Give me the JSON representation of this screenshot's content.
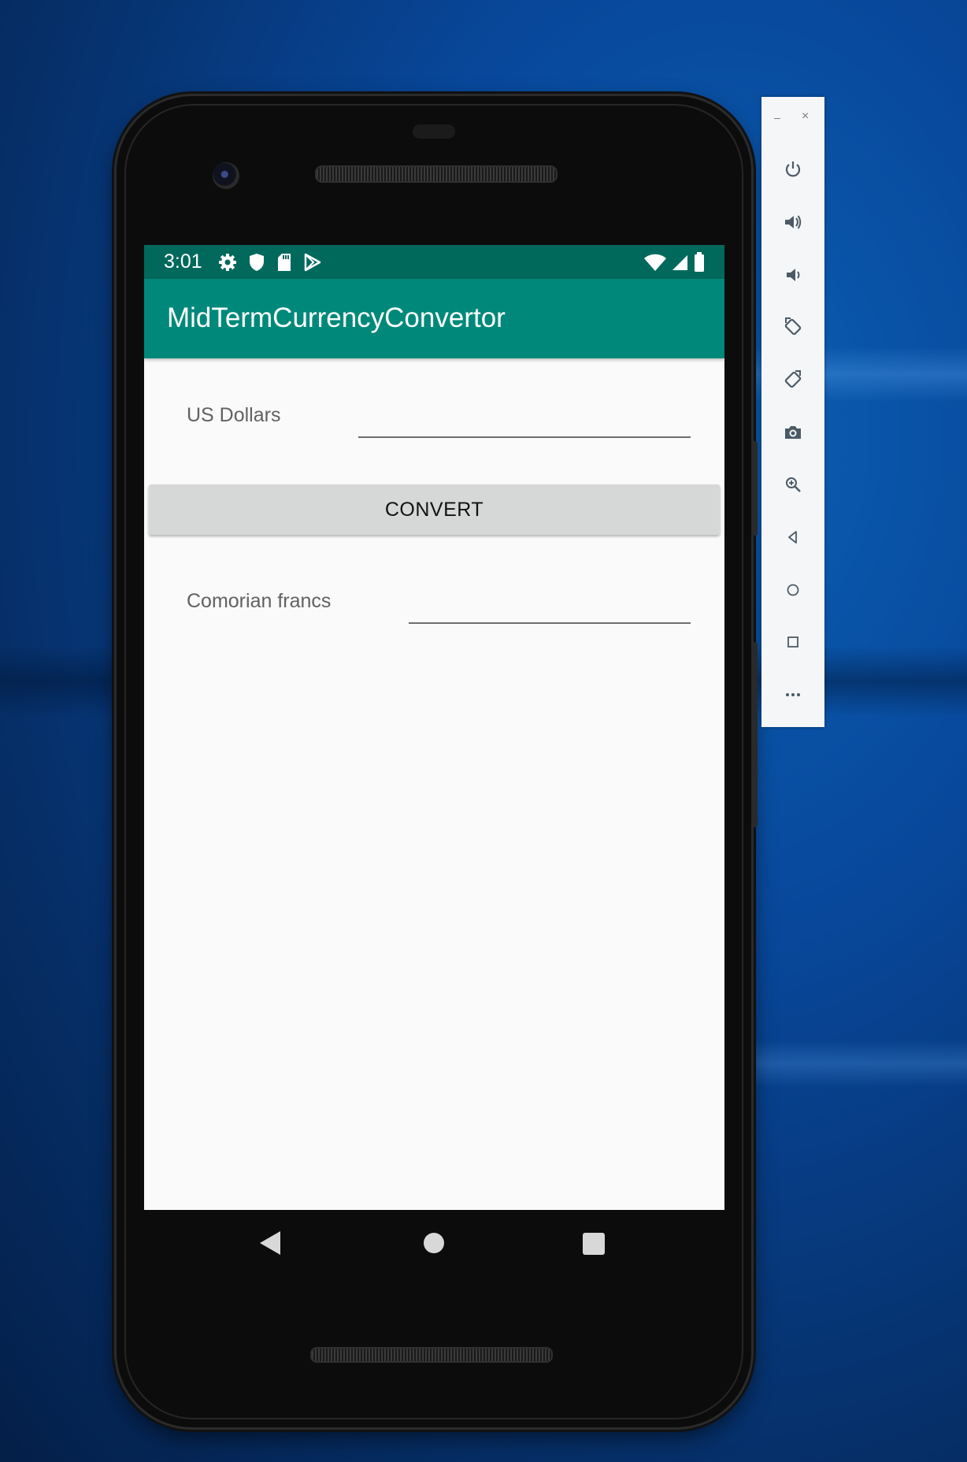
{
  "status_bar": {
    "time": "3:01"
  },
  "app": {
    "title": "MidTermCurrencyConvertor"
  },
  "form": {
    "from_label": "US Dollars",
    "from_value": "",
    "convert_button": "CONVERT",
    "to_label": "Comorian francs",
    "to_value": ""
  },
  "toolbar": {
    "minimize": "–",
    "close": "×",
    "buttons": [
      "power-icon",
      "volume-up-icon",
      "volume-down-icon",
      "rotate-left-icon",
      "rotate-right-icon",
      "camera-icon",
      "zoom-icon",
      "back-icon",
      "home-icon",
      "overview-icon",
      "more-icon"
    ]
  },
  "colors": {
    "status_bar": "#00695c",
    "app_bar": "#00897b",
    "button": "#d6d7d7"
  }
}
